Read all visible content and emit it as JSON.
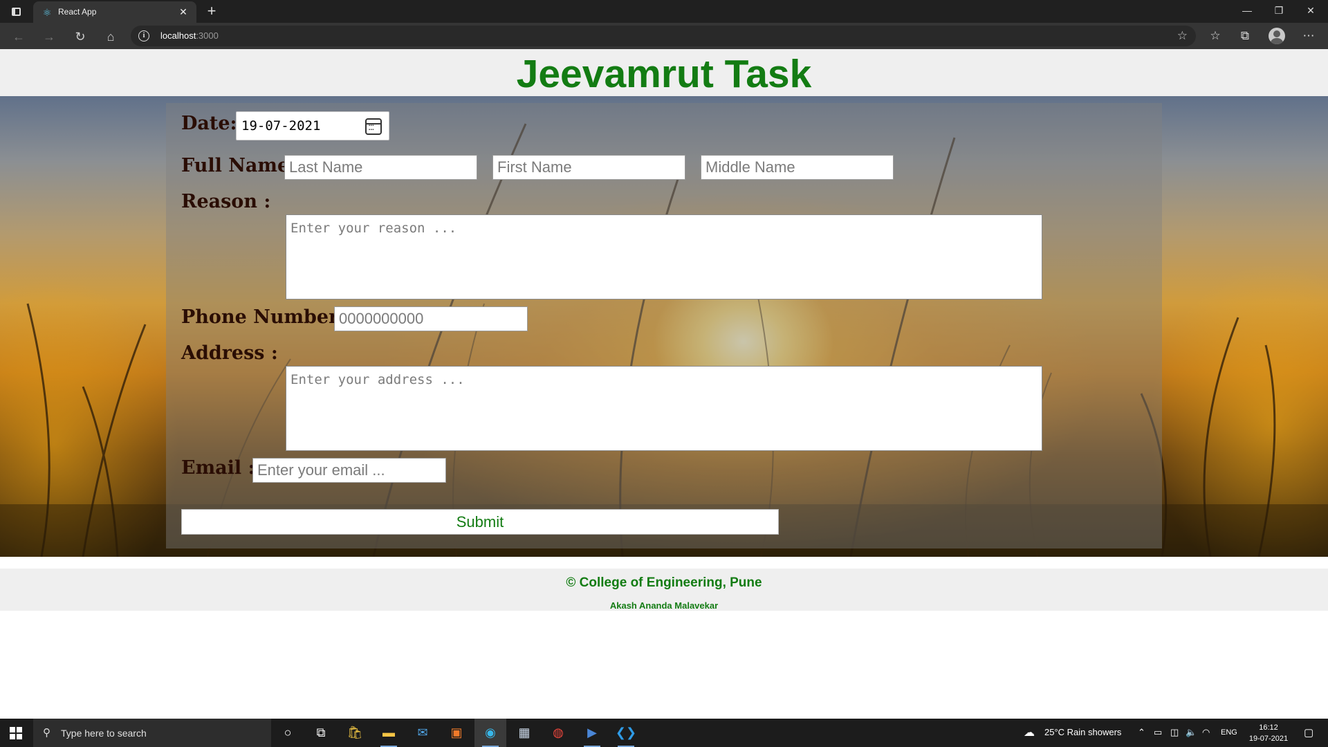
{
  "browser": {
    "tab_title": "React App",
    "url_host": "localhost",
    "url_port": ":3000"
  },
  "page": {
    "title": "Jeevamrut Task"
  },
  "form": {
    "date_label": "Date:",
    "date_value": "19-07-2021",
    "full_name_label": "Full Name:",
    "last_name_placeholder": "Last Name",
    "first_name_placeholder": "First Name",
    "middle_name_placeholder": "Middle Name",
    "reason_label": "Reason :",
    "reason_placeholder": "Enter your reason ...",
    "phone_label": "Phone Number :",
    "phone_placeholder": "0000000000",
    "address_label": "Address :",
    "address_placeholder": "Enter your address ...",
    "email_label": "Email :",
    "email_placeholder": "Enter your email ...",
    "submit_label": "Submit"
  },
  "footer": {
    "copyright": "© College of Engineering, Pune",
    "author": "Akash Ananda Malavekar"
  },
  "taskbar": {
    "search_placeholder": "Type here to search",
    "weather": "25°C  Rain showers",
    "language": "ENG",
    "time": "16:12",
    "date": "19-07-2021"
  },
  "colors": {
    "accent_green": "#137c13",
    "label_brown": "#2a0d04"
  }
}
